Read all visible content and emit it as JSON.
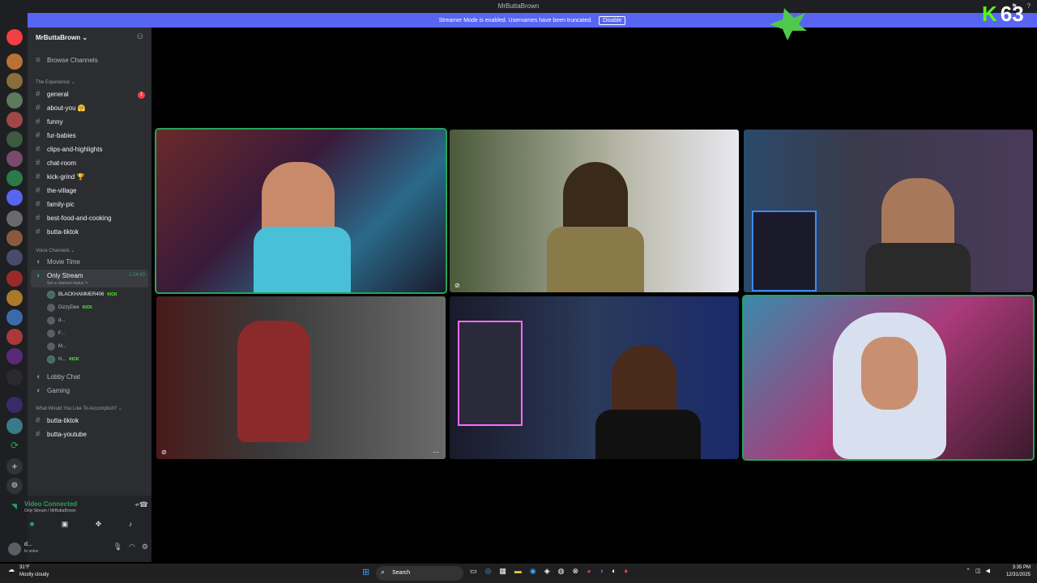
{
  "titlebar": {
    "title": "MrButtaBrown"
  },
  "banner": {
    "text": "Streamer Mode is enabled. Usernames have been truncated.",
    "button": "Disable"
  },
  "overlay": {
    "k_letter": "K",
    "count": "63"
  },
  "server": {
    "name": "MrButtaBrown ⌄",
    "browse": "Browse Channels"
  },
  "categories": {
    "experience": "The Experience ⌄",
    "voice": "Voice Channels ⌄",
    "accomplish": "What Would You Like To Accomplish? ⌄"
  },
  "text_channels": [
    {
      "name": "general",
      "badge": "1"
    },
    {
      "name": "about-you 🤗"
    },
    {
      "name": "funny"
    },
    {
      "name": "fur-babies"
    },
    {
      "name": "clips-and-highlights"
    },
    {
      "name": "chat-room"
    },
    {
      "name": "kick-grind 🏆"
    },
    {
      "name": "the-village"
    },
    {
      "name": "family-pic"
    },
    {
      "name": "best-food-and-cooking"
    },
    {
      "name": "butta-tiktok"
    }
  ],
  "voice_channels": {
    "movie_time": "Movie Time",
    "only_stream": "Only Stream",
    "only_stream_time": "1:24:43",
    "only_stream_status": "Set a channel status ✎",
    "lobby_chat": "Lobby Chat",
    "gaming": "Gaming"
  },
  "voice_users": [
    {
      "name": "BLACKHAMMER406",
      "kick": "KICK"
    },
    {
      "name": "DizzyDee",
      "kick": "KICK"
    },
    {
      "name": "d..."
    },
    {
      "name": "F..."
    },
    {
      "name": "M..."
    },
    {
      "name": "N...",
      "kick": "KICK"
    }
  ],
  "accomplish_channels": [
    "butta-tiktok",
    "butta-youtube"
  ],
  "connection": {
    "status": "Video Connected",
    "channel": "Only Stream / MrButtaBrown"
  },
  "user": {
    "name": "d...",
    "status": "In voice"
  },
  "taskbar": {
    "weather_temp": "31°F",
    "weather_desc": "Mostly cloudy",
    "search": "Search",
    "time": "3:35 PM",
    "date": "12/31/2025"
  },
  "colors": {
    "accent": "#5865f2",
    "speaking": "#23a55a",
    "kick": "#53fc18"
  }
}
